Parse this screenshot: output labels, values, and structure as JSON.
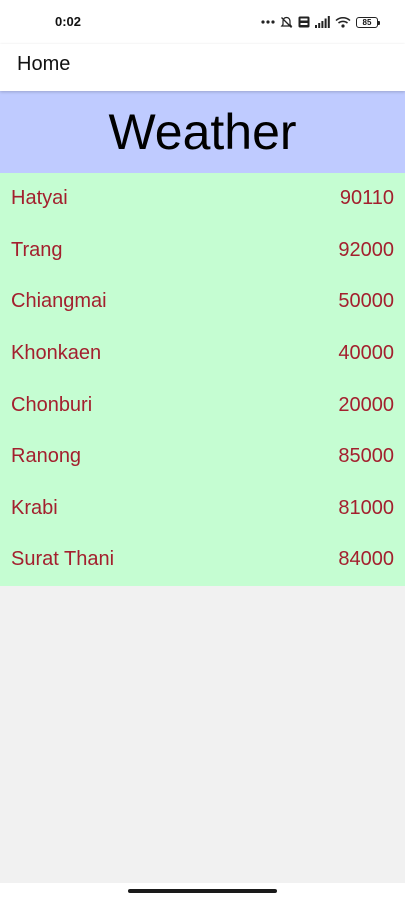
{
  "status_bar": {
    "time": "0:02",
    "battery_level": "85",
    "icons": [
      "more-dots-icon",
      "alarm-off-icon",
      "volte-icon",
      "signal-icon",
      "wifi-icon",
      "battery-icon"
    ]
  },
  "app_bar": {
    "title": "Home"
  },
  "header": {
    "title": "Weather"
  },
  "cities": [
    {
      "name": "Hatyai",
      "code": "90110"
    },
    {
      "name": "Trang",
      "code": "92000"
    },
    {
      "name": "Chiangmai",
      "code": "50000"
    },
    {
      "name": "Khonkaen",
      "code": "40000"
    },
    {
      "name": "Chonburi",
      "code": "20000"
    },
    {
      "name": "Ranong",
      "code": "85000"
    },
    {
      "name": "Krabi",
      "code": "81000"
    },
    {
      "name": "Surat Thani",
      "code": "84000"
    }
  ],
  "colors": {
    "header_bg": "#bfcbff",
    "list_bg": "#c5fdd2",
    "list_text": "#a3202e",
    "page_bg": "#f1f1f1"
  }
}
